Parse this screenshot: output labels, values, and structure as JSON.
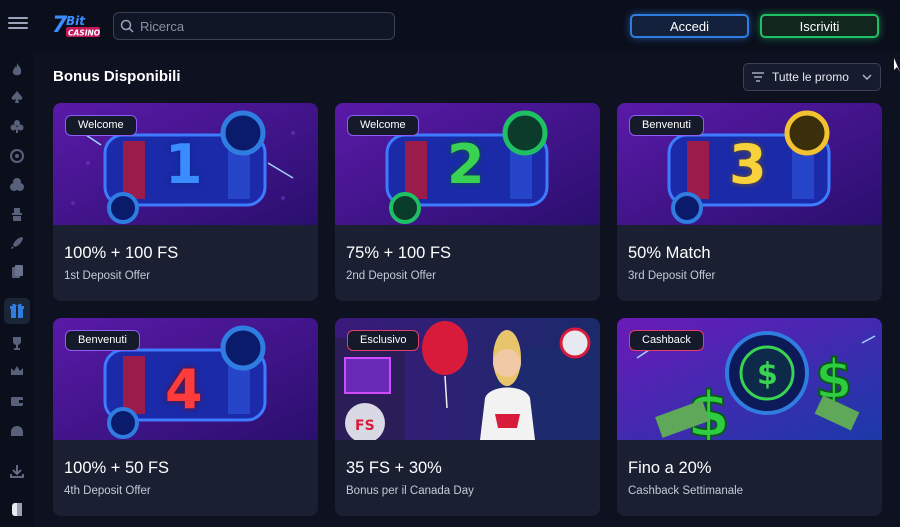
{
  "header": {
    "logo_text": "7Bit CASINO",
    "search_placeholder": "Ricerca",
    "login_label": "Accedi",
    "signup_label": "Iscriviti"
  },
  "sidebar": {
    "items": [
      {
        "icon": "flame-icon"
      },
      {
        "icon": "spade-icon"
      },
      {
        "icon": "club-icon"
      },
      {
        "icon": "roulette-icon"
      },
      {
        "icon": "dice-icon"
      },
      {
        "icon": "dealer-icon"
      },
      {
        "icon": "rocket-icon"
      },
      {
        "icon": "cards-icon"
      },
      {
        "icon": "gift-icon",
        "active": true
      },
      {
        "icon": "trophy-icon"
      },
      {
        "icon": "crown-icon"
      },
      {
        "icon": "wallet-icon"
      },
      {
        "icon": "chat-icon"
      },
      {
        "icon": "download-icon"
      },
      {
        "icon": "avatar-icon"
      }
    ]
  },
  "main": {
    "section_title": "Bonus Disponibili",
    "filter_label": "Tutte le promo",
    "cards": [
      {
        "badge": "Welcome",
        "title": "100% + 100 FS",
        "subtitle": "1st Deposit Offer",
        "digit": "1",
        "theme": "slot-blue"
      },
      {
        "badge": "Welcome",
        "title": "75% + 100 FS",
        "subtitle": "2nd Deposit Offer",
        "digit": "2",
        "theme": "slot-green"
      },
      {
        "badge": "Benvenuti",
        "title": "50% Match",
        "subtitle": "3rd Deposit Offer",
        "digit": "3",
        "theme": "slot-gold"
      },
      {
        "badge": "Benvenuti",
        "title": "100% + 50 FS",
        "subtitle": "4th Deposit Offer",
        "digit": "4",
        "theme": "slot-red"
      },
      {
        "badge": "Esclusivo",
        "title": "35 FS + 30%",
        "subtitle": "Bonus per il Canada Day",
        "digit": "",
        "theme": "canada"
      },
      {
        "badge": "Cashback",
        "title": "Fino a 20%",
        "subtitle": "Cashback Settimanale",
        "digit": "",
        "theme": "cashback"
      }
    ]
  },
  "colors": {
    "background": "#0d1120",
    "card": "#1a2032",
    "login_border": "#2f7de1",
    "signup_border": "#1fbf63",
    "badge_purple": "#8b5cf6",
    "badge_red": "#e53e6b"
  }
}
